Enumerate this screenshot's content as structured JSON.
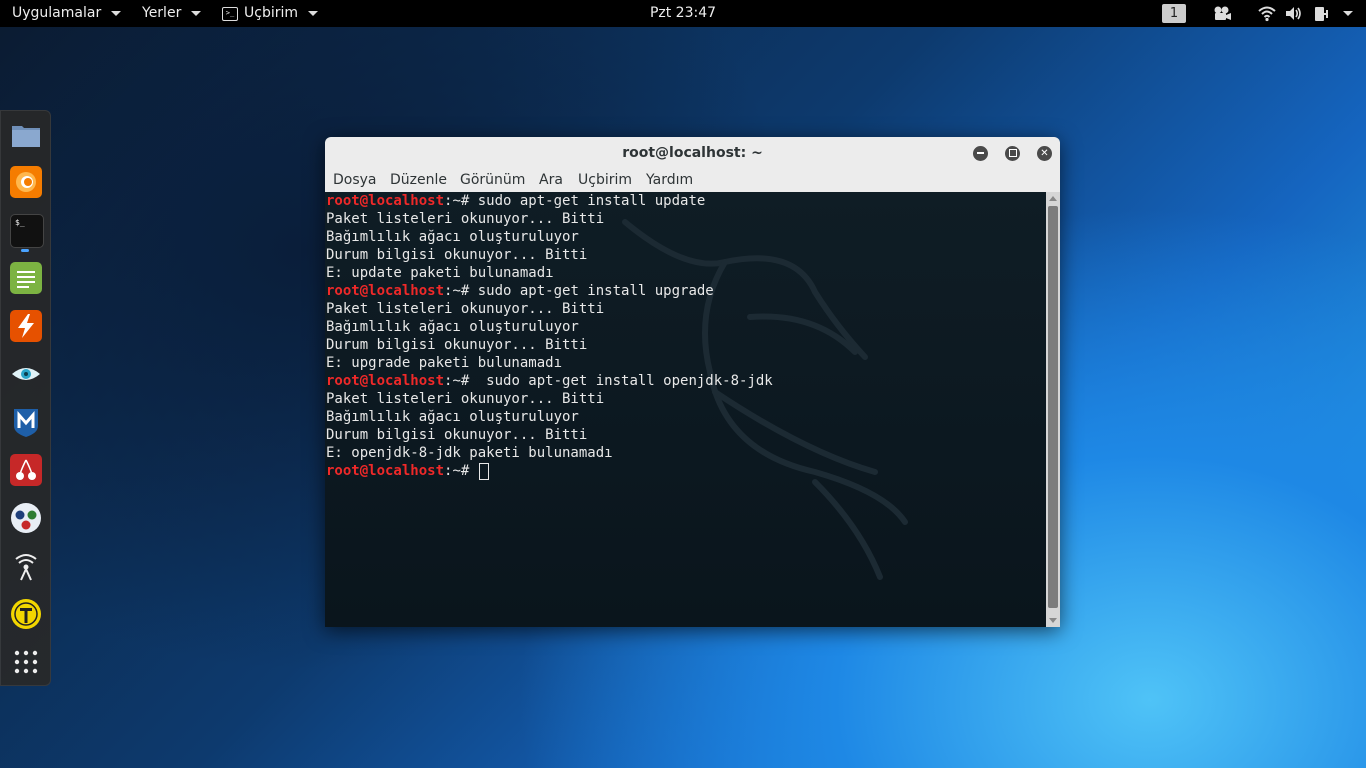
{
  "topbar": {
    "apps_label": "Uygulamalar",
    "places_label": "Yerler",
    "terminal_label": "Uçbirim",
    "clock": "Pzt 23:47",
    "workspace": "1"
  },
  "dock": {
    "items": [
      "files-icon",
      "firefox-icon",
      "terminal-icon",
      "notes-icon",
      "burpsuite-icon",
      "eye-icon",
      "metasploit-icon",
      "cherrytree-icon",
      "maltego-icon",
      "wifi-tool-icon",
      "radio-tool-icon",
      "show-apps-icon"
    ]
  },
  "window": {
    "title": "root@localhost: ~",
    "menu": [
      "Dosya",
      "Düzenle",
      "Görünüm",
      "Ara",
      "Uçbirim",
      "Yardım"
    ]
  },
  "terminal": {
    "host": "root@localhost",
    "path_prompt": ":~# ",
    "lines": [
      {
        "type": "prompt",
        "cmd": "sudo apt-get install update"
      },
      {
        "type": "out",
        "text": "Paket listeleri okunuyor... Bitti"
      },
      {
        "type": "out",
        "text": "Bağımlılık ağacı oluşturuluyor"
      },
      {
        "type": "out",
        "text": "Durum bilgisi okunuyor... Bitti"
      },
      {
        "type": "out",
        "text": "E: update paketi bulunamadı"
      },
      {
        "type": "prompt",
        "cmd": "sudo apt-get install upgrade"
      },
      {
        "type": "out",
        "text": "Paket listeleri okunuyor... Bitti"
      },
      {
        "type": "out",
        "text": "Bağımlılık ağacı oluşturuluyor"
      },
      {
        "type": "out",
        "text": "Durum bilgisi okunuyor... Bitti"
      },
      {
        "type": "out",
        "text": "E: upgrade paketi bulunamadı"
      },
      {
        "type": "prompt",
        "cmd": " sudo apt-get install openjdk-8-jdk"
      },
      {
        "type": "out",
        "text": "Paket listeleri okunuyor... Bitti"
      },
      {
        "type": "out",
        "text": "Bağımlılık ağacı oluşturuluyor"
      },
      {
        "type": "out",
        "text": "Durum bilgisi okunuyor... Bitti"
      },
      {
        "type": "out",
        "text": "E: openjdk-8-jdk paketi bulunamadı"
      },
      {
        "type": "prompt",
        "cmd": "",
        "cursor": true
      }
    ]
  }
}
